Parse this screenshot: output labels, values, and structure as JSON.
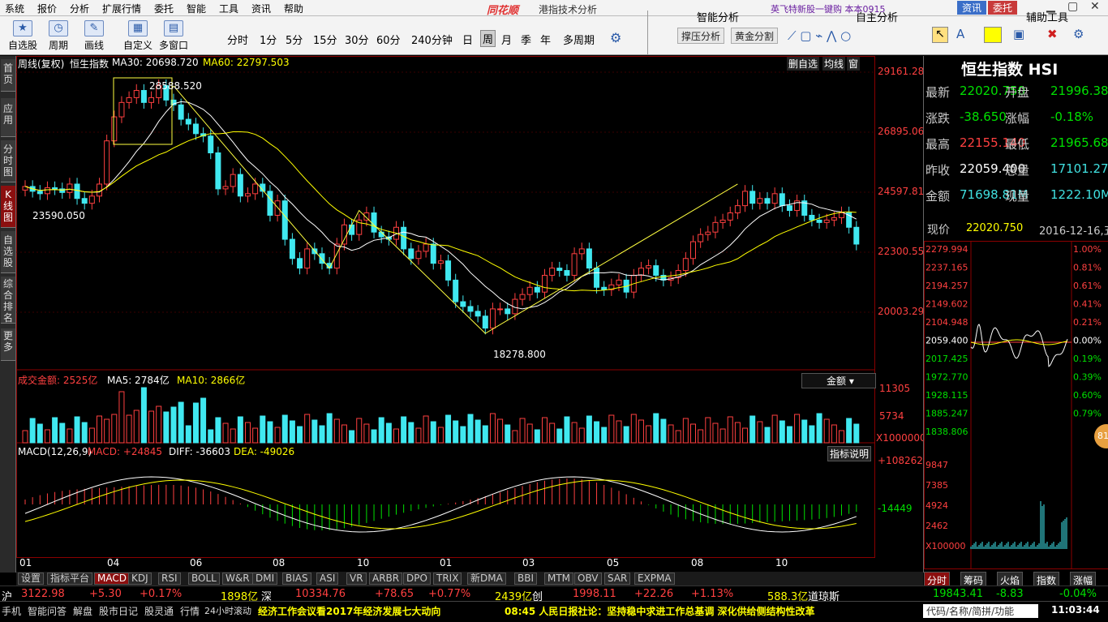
{
  "menu": [
    "系统",
    "报价",
    "分析",
    "扩展行情",
    "委托",
    "智能",
    "工具",
    "资讯",
    "帮助"
  ],
  "app": {
    "brand": "同花顺",
    "title": "港指技术分析",
    "ticker": "英飞特新股一键购 本本0915",
    "acct": "资讯",
    "trade": "委托"
  },
  "toolbar": {
    "buttons": [
      "自选股",
      "周期",
      "画线",
      "自定义",
      "多窗口"
    ],
    "periods": [
      "分时",
      "1分",
      "5分",
      "15分",
      "30分",
      "60分",
      "240分钟",
      "日",
      "周",
      "月",
      "季",
      "年",
      "多周期"
    ],
    "period_selected": "周",
    "panels": [
      "智能分析",
      "自主分析",
      "辅助工具"
    ],
    "smart_btns": [
      "撑压分析",
      "黄金分割"
    ]
  },
  "left_tabs": [
    "首页",
    "应用",
    "分时图",
    "K线图",
    "自选股",
    "综合排名",
    "更多"
  ],
  "chart": {
    "header": {
      "period": "周线(复权)",
      "name": "恒生指数",
      "ma30_label": "MA30: 20698.720",
      "ma60_label": "MA60: 22797.503"
    },
    "top_right": [
      "删自选",
      "均线",
      "窗"
    ],
    "price_axis": [
      "29161.28",
      "26895.06",
      "24597.81",
      "22300.55",
      "20003.29"
    ],
    "annotations": {
      "high": "28588.520",
      "low": "18278.800",
      "left": "23590.050"
    },
    "volume": {
      "label": "成交金额: 2525亿",
      "ma5": "MA5: 2784亿",
      "ma10": "MA10: 2866亿",
      "axis": [
        "11305",
        "5734",
        "X1000000"
      ],
      "selector": "金额"
    },
    "macd": {
      "label": "MACD(12,26,9)",
      "macd": "MACD: +24845",
      "diff": "DIFF: -36603",
      "dea": "DEA: -49026",
      "axis": [
        "+108262",
        "-14449"
      ],
      "help": "指标说明"
    },
    "months": [
      "01",
      "04",
      "06",
      "08",
      "10",
      "01",
      "03",
      "05",
      "08",
      "10"
    ]
  },
  "chart_data": {
    "type": "candlestick",
    "period": "weekly",
    "ma": [
      "MA30",
      "MA60"
    ],
    "closes": [
      24400,
      24200,
      24100,
      24350,
      24300,
      24150,
      24500,
      23900,
      23700,
      24000,
      24500,
      26300,
      27300,
      27900,
      28100,
      28400,
      27900,
      28100,
      28600,
      28000,
      27800,
      27200,
      27000,
      26600,
      26500,
      25800,
      24300,
      24400,
      24900,
      24000,
      24100,
      24500,
      24200,
      23200,
      23800,
      22200,
      21400,
      21000,
      21800,
      21600,
      21200,
      21000,
      22000,
      22800,
      22400,
      23000,
      23300,
      22500,
      22300,
      22200,
      22700,
      21800,
      21400,
      21700,
      22000,
      21200,
      21300,
      20500,
      19600,
      19400,
      19200,
      19000,
      18500,
      19300,
      19300,
      19100,
      19700,
      19900,
      20200,
      20000,
      20700,
      21000,
      20900,
      20700,
      21600,
      21800,
      21000,
      20200,
      20100,
      20300,
      20500,
      20000,
      20700,
      21000,
      21100,
      20700,
      20500,
      20600,
      20900,
      21400,
      22100,
      22400,
      22500,
      22900,
      23000,
      23300,
      23600,
      24200,
      23700,
      23900,
      23700,
      24100,
      23600,
      23400,
      23800,
      23200,
      23000,
      22900,
      23000,
      23100,
      23300,
      22700,
      22000
    ]
  },
  "volume_note": "weekly turnover bars",
  "quote": {
    "name": "恒生指数 HSI",
    "rows": [
      {
        "l": "最新",
        "v": "22020.750",
        "l2": "开盘",
        "v2": "21996.380"
      },
      {
        "l": "涨跌",
        "v": "-38.650",
        "l2": "涨幅",
        "v2": "-0.18%"
      },
      {
        "l": "最高",
        "v": "22155.140",
        "l2": "最低",
        "v2": "21965.680"
      },
      {
        "l": "昨收",
        "v": "22059.400",
        "l2": "总量",
        "v2": "17101.27M"
      },
      {
        "l": "金额",
        "v": "71698.81M",
        "l2": "现量",
        "v2": "1222.10M"
      }
    ],
    "now_label": "现价",
    "now_price": "22020.750",
    "date": "2016-12-16,五",
    "intraday_axis_left": [
      "2279.994",
      "2237.165",
      "2194.257",
      "2149.602",
      "2104.948",
      "2059.400",
      "2017.425",
      "1972.770",
      "1928.115",
      "1885.247",
      "1838.806"
    ],
    "intraday_axis_right": [
      "1.00%",
      "0.81%",
      "0.61%",
      "0.41%",
      "0.21%",
      "0.00%",
      "0.19%",
      "0.39%",
      "0.60%",
      "0.79%"
    ],
    "vol_axis": [
      "9847",
      "7385",
      "4924",
      "2462",
      "X100000"
    ],
    "tabs": [
      "分时",
      "筹码",
      "火焰",
      "指数",
      "涨幅"
    ],
    "badge": "81"
  },
  "indices": [
    {
      "name": "沪",
      "v": "3122.98",
      "c": "+5.30",
      "p": "+0.17%",
      "amt": "1898亿"
    },
    {
      "name": "深",
      "v": "10334.76",
      "c": "+78.65",
      "p": "+0.77%",
      "amt": "2439亿"
    },
    {
      "name": "创",
      "v": "1998.11",
      "c": "+22.26",
      "p": "+1.13%",
      "amt": "588.3亿"
    },
    {
      "name": "道琼斯",
      "v": "19843.41",
      "c": "-8.83",
      "p": "-0.04%"
    }
  ],
  "bottom_tabs": [
    "设置",
    "指标平台",
    "MACD",
    "KDJ",
    "RSI",
    "BOLL",
    "W&R",
    "DMI",
    "BIAS",
    "ASI",
    "VR",
    "ARBR",
    "DPO",
    "TRIX",
    "新DMA",
    "BBI",
    "MTM",
    "OBV",
    "SAR",
    "EXPMA"
  ],
  "status": {
    "items": [
      "手机",
      "智能问答",
      "解盘",
      "股市日记",
      "股灵通",
      "行情",
      "24小时滚动"
    ],
    "news1": "经济工作会议看2017年经济发展七大动向",
    "news2": "08:45 人民日报社论：坚持稳中求进工作总基调 深化供给侧结构性改革",
    "search": "代码/名称/简拼/功能",
    "time": "11:03:44"
  }
}
